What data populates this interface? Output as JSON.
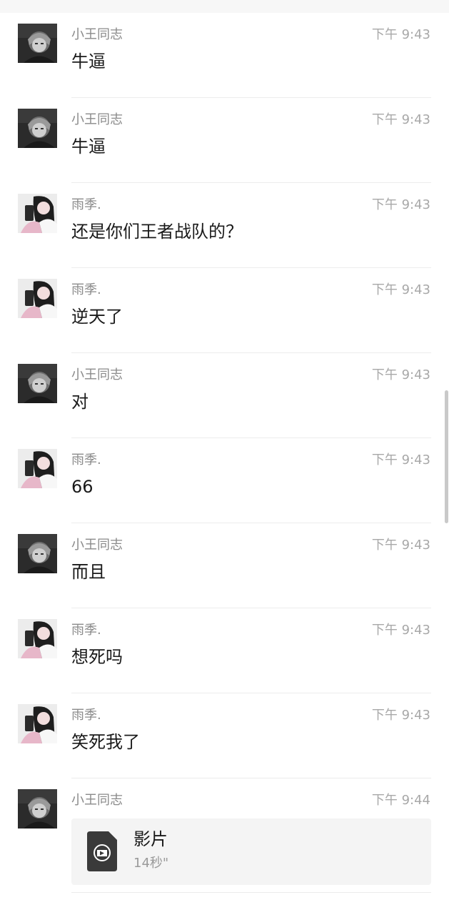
{
  "messages": [
    {
      "sender": "小王同志",
      "time": "下午 9:43",
      "text": "牛逼",
      "avatar": "boy"
    },
    {
      "sender": "小王同志",
      "time": "下午 9:43",
      "text": "牛逼",
      "avatar": "boy"
    },
    {
      "sender": "雨季.",
      "time": "下午 9:43",
      "text": "还是你们王者战队的？",
      "avatar": "girl"
    },
    {
      "sender": "雨季.",
      "time": "下午 9:43",
      "text": "逆天了",
      "avatar": "girl"
    },
    {
      "sender": "小王同志",
      "time": "下午 9:43",
      "text": "对",
      "avatar": "boy"
    },
    {
      "sender": "雨季.",
      "time": "下午 9:43",
      "text": "66",
      "avatar": "girl"
    },
    {
      "sender": "小王同志",
      "time": "下午 9:43",
      "text": "而且",
      "avatar": "boy"
    },
    {
      "sender": "雨季.",
      "time": "下午 9:43",
      "text": "想死吗",
      "avatar": "girl"
    },
    {
      "sender": "雨季.",
      "time": "下午 9:43",
      "text": "笑死我了",
      "avatar": "girl"
    }
  ],
  "video_message": {
    "sender": "小王同志",
    "time": "下午 9:44",
    "title": "影片",
    "duration": "14秒\"",
    "avatar": "boy",
    "icon": "video-file-icon"
  }
}
